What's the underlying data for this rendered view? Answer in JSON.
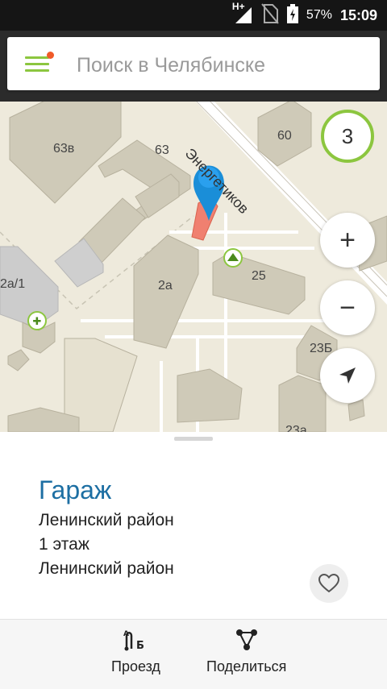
{
  "statusbar": {
    "network": "H+",
    "battery": "57%",
    "time": "15:09"
  },
  "search": {
    "placeholder": "Поиск в Челябинске"
  },
  "map": {
    "street_label": "Энергетиков",
    "buildings": [
      "63в",
      "63",
      "60",
      "2а/1",
      "2а",
      "25",
      "23Б",
      "23а"
    ],
    "cluster_count": "3",
    "zoom_in_label": "+",
    "zoom_out_label": "−"
  },
  "place": {
    "title": "Гараж",
    "lines": [
      "Ленинский район",
      "1 этаж",
      "Ленинский район"
    ]
  },
  "actions": {
    "route_label": "Проезд",
    "share_label": "Поделиться"
  },
  "colors": {
    "accent": "#8cc63f",
    "title": "#1d6fa3",
    "pin": "#1a8ed8",
    "selected_building": "#f08070"
  }
}
